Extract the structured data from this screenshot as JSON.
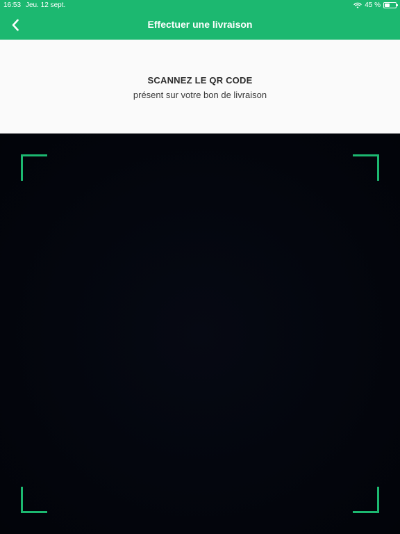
{
  "status_bar": {
    "time": "16:53",
    "date": "Jeu. 12 sept.",
    "battery_text": "45 %",
    "battery_level": 0.45
  },
  "navbar": {
    "title": "Effectuer une livraison",
    "back_icon": "chevron-left-icon"
  },
  "instructions": {
    "heading": "SCANNEZ LE QR CODE",
    "subtext": "présent sur votre bon de livraison"
  },
  "colors": {
    "accent": "#1cb870",
    "info_background": "#fafafa",
    "camera_background": "#03050d"
  }
}
